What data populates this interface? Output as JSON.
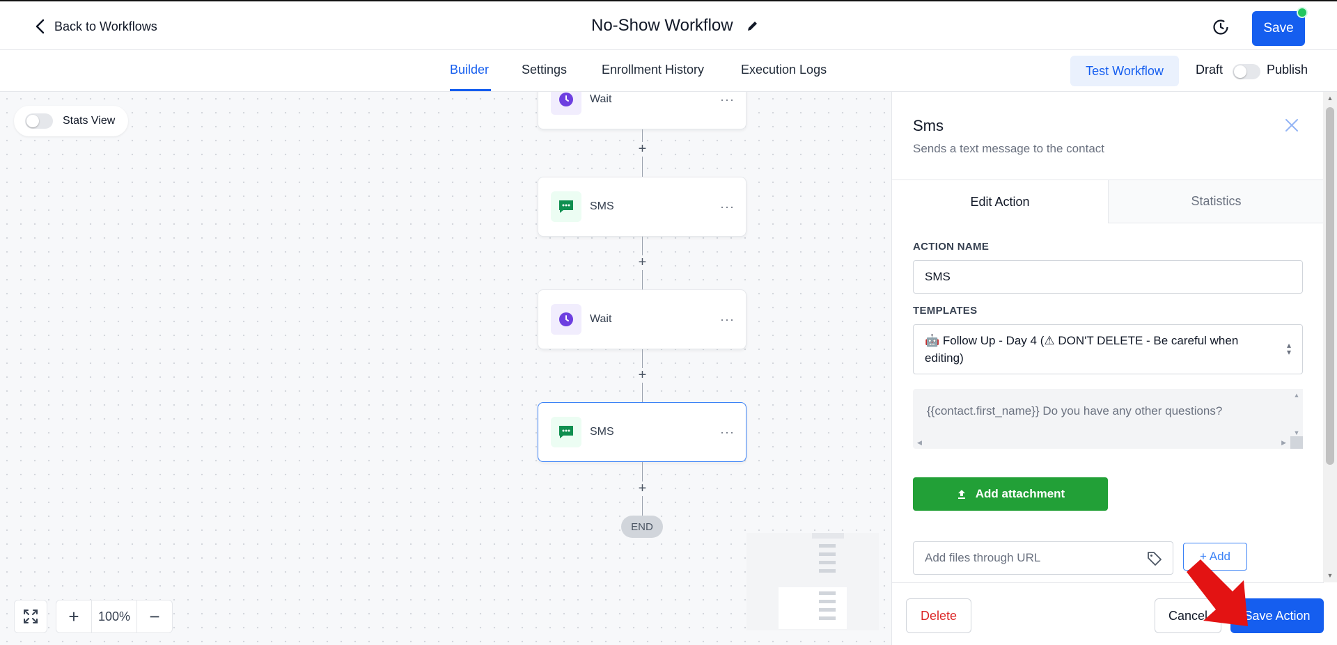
{
  "header": {
    "back_label": "Back to Workflows",
    "workflow_title": "No-Show Workflow",
    "save_label": "Save"
  },
  "nav": {
    "tabs": [
      {
        "label": "Builder",
        "active": true
      },
      {
        "label": "Settings"
      },
      {
        "label": "Enrollment History"
      },
      {
        "label": "Execution Logs"
      }
    ],
    "test_workflow_label": "Test Workflow",
    "draft_label": "Draft",
    "publish_label": "Publish",
    "publish_on": false
  },
  "canvas": {
    "stats_view_label": "Stats View",
    "stats_view_on": false,
    "nodes": [
      {
        "type": "wait",
        "label": "Wait"
      },
      {
        "type": "sms",
        "label": "SMS"
      },
      {
        "type": "wait",
        "label": "Wait"
      },
      {
        "type": "sms",
        "label": "SMS",
        "selected": true
      }
    ],
    "end_label": "END",
    "zoom_level": "100%"
  },
  "panel": {
    "title": "Sms",
    "subtitle": "Sends a text message to the contact",
    "tabs": [
      "Edit Action",
      "Statistics"
    ],
    "action_name_label": "ACTION NAME",
    "action_name_value": "SMS",
    "templates_label": "TEMPLATES",
    "template_value": "🤖 Follow Up - Day 4 (⚠ DON'T DELETE - Be careful when editing)",
    "message_text": "{{contact.first_name}} Do you have any other questions?",
    "add_attachment_label": "Add attachment",
    "url_placeholder": "Add files through URL",
    "add_label": "+ Add",
    "delete_label": "Delete",
    "cancel_label": "Cancel",
    "save_action_label": "Save Action"
  },
  "colors": {
    "primary": "#155eef",
    "success": "#22a037",
    "danger": "#dc2626",
    "annotation_arrow": "#e31313"
  }
}
